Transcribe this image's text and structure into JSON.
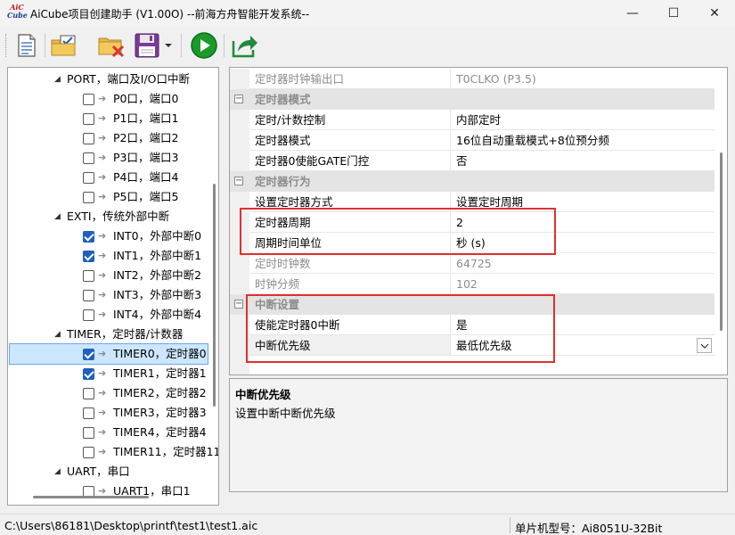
{
  "window": {
    "title": "AiCube项目创建助手 (V1.00O) --前海方舟智能开发系统--",
    "logo_line1": "AiC",
    "logo_line2": "Cube",
    "controls": {
      "minimize": "—",
      "maximize": "☐",
      "close": "✕"
    }
  },
  "toolbar": {
    "items": [
      {
        "icon": "new-document-icon"
      },
      {
        "icon": "open-folder-checklist-icon"
      },
      {
        "icon": "close-folder-icon"
      },
      {
        "icon": "save-icon"
      },
      {
        "icon": "save-dropdown-icon"
      },
      {
        "icon": "run-icon"
      },
      {
        "icon": "export-icon"
      }
    ],
    "colors": {
      "run": "#1a9a2a",
      "export": "#1e8a3a",
      "folder": "#e9b949",
      "save": "#7b3a9a",
      "close_x": "#d9362f"
    }
  },
  "tree": {
    "groups": [
      {
        "label": "PORT，端口及I/O口中断",
        "children": [
          {
            "label": "P0口，端口0",
            "checked": false
          },
          {
            "label": "P1口，端口1",
            "checked": false
          },
          {
            "label": "P2口，端口2",
            "checked": false
          },
          {
            "label": "P3口，端口3",
            "checked": false
          },
          {
            "label": "P4口，端口4",
            "checked": false
          },
          {
            "label": "P5口，端口5",
            "checked": false
          }
        ]
      },
      {
        "label": "EXTI，传统外部中断",
        "children": [
          {
            "label": "INT0，外部中断0",
            "checked": true
          },
          {
            "label": "INT1，外部中断1",
            "checked": true
          },
          {
            "label": "INT2，外部中断2",
            "checked": false
          },
          {
            "label": "INT3，外部中断3",
            "checked": false
          },
          {
            "label": "INT4，外部中断4",
            "checked": false
          }
        ]
      },
      {
        "label": "TIMER，定时器/计数器",
        "children": [
          {
            "label": "TIMER0，定时器0",
            "checked": true,
            "selected": true
          },
          {
            "label": "TIMER1，定时器1",
            "checked": true
          },
          {
            "label": "TIMER2，定时器2",
            "checked": false
          },
          {
            "label": "TIMER3，定时器3",
            "checked": false
          },
          {
            "label": "TIMER4，定时器4",
            "checked": false
          },
          {
            "label": "TIMER11，定时器11",
            "checked": false
          }
        ]
      },
      {
        "label": "UART，串口",
        "children": [
          {
            "label": "UART1，串口1",
            "checked": false
          }
        ]
      }
    ]
  },
  "grid": {
    "rows": [
      {
        "type": "prop",
        "name": "定时器时钟输出口",
        "value": "T0CLKO (P3.5)",
        "disabled": true
      },
      {
        "type": "cat",
        "name": "定时器模式",
        "expander": "⊟"
      },
      {
        "type": "prop",
        "name": "定时/计数控制",
        "value": "内部定时"
      },
      {
        "type": "prop",
        "name": "定时器模式",
        "value": "16位自动重载模式+8位预分频"
      },
      {
        "type": "prop",
        "name": "定时器0使能GATE门控",
        "value": "否"
      },
      {
        "type": "cat",
        "name": "定时器行为",
        "expander": "⊟"
      },
      {
        "type": "prop",
        "name": "设置定时器方式",
        "value": "设置定时周期"
      },
      {
        "type": "prop",
        "name": "定时器周期",
        "value": "2"
      },
      {
        "type": "prop",
        "name": "周期时间单位",
        "value": "秒 (s)"
      },
      {
        "type": "prop",
        "name": "定时时钟数",
        "value": "64725",
        "disabled": true
      },
      {
        "type": "prop",
        "name": "时钟分频",
        "value": "102",
        "disabled": true
      },
      {
        "type": "cat",
        "name": "中断设置",
        "expander": "⊟"
      },
      {
        "type": "prop",
        "name": "使能定时器0中断",
        "value": "是"
      },
      {
        "type": "prop",
        "name": "中断优先级",
        "value": "最低优先级",
        "dropdown": true
      }
    ]
  },
  "description": {
    "title": "中断优先级",
    "text": "设置中断中断优先级"
  },
  "status": {
    "path": "C:\\Users\\86181\\Desktop\\printf\\test1\\test1.aic",
    "model": "单片机型号：Ai8051U-32Bit"
  },
  "highlight_color": "#e03030"
}
